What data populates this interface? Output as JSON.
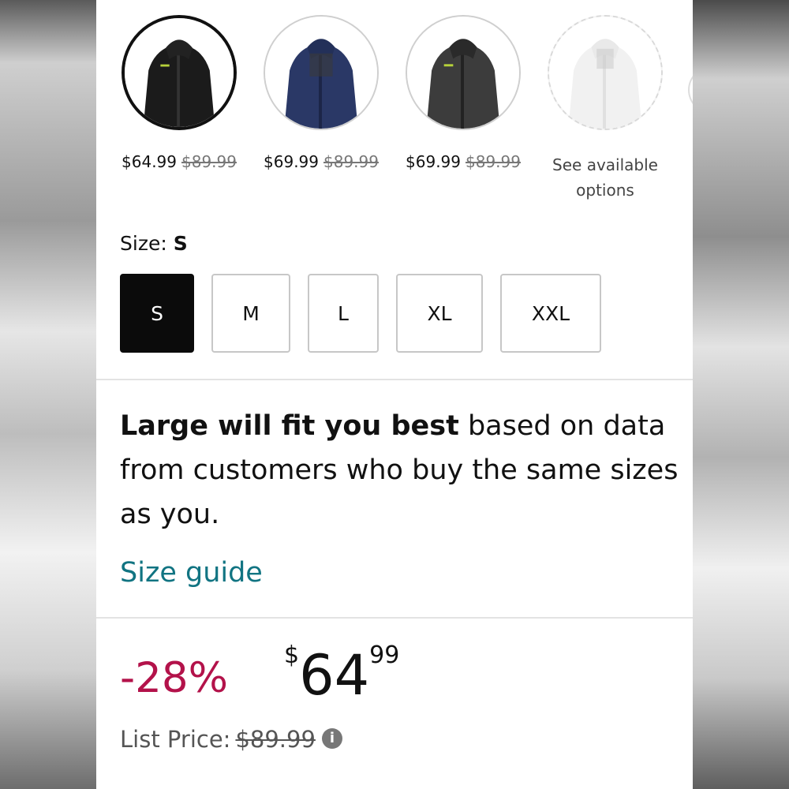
{
  "colors": {
    "accent_link": "#117482",
    "discount": "#b3124a",
    "selected": "#0b0b0b"
  },
  "swatches": [
    {
      "name": "black-jacket",
      "price": "$64.99",
      "was": "$89.99",
      "selected": true
    },
    {
      "name": "navy-jacket",
      "price": "$69.99",
      "was": "$89.99",
      "selected": false
    },
    {
      "name": "grey-jacket",
      "price": "$69.99",
      "was": "$89.99",
      "selected": false
    },
    {
      "name": "white-jacket",
      "availability_line1": "See available",
      "availability_line2": "options",
      "available": false
    }
  ],
  "size": {
    "label": "Size: ",
    "selected": "S",
    "options": [
      "S",
      "M",
      "L",
      "XL",
      "XXL"
    ]
  },
  "fit": {
    "bold": "Large will fit you best",
    "rest": " based on data from customers who buy the same sizes as you."
  },
  "size_guide": "Size guide",
  "price": {
    "discount": "-28%",
    "currency": "$",
    "whole": "64",
    "fraction": "99",
    "list_label": "List Price:",
    "list_value": "$89.99"
  },
  "icons": {
    "info": "info-icon"
  }
}
